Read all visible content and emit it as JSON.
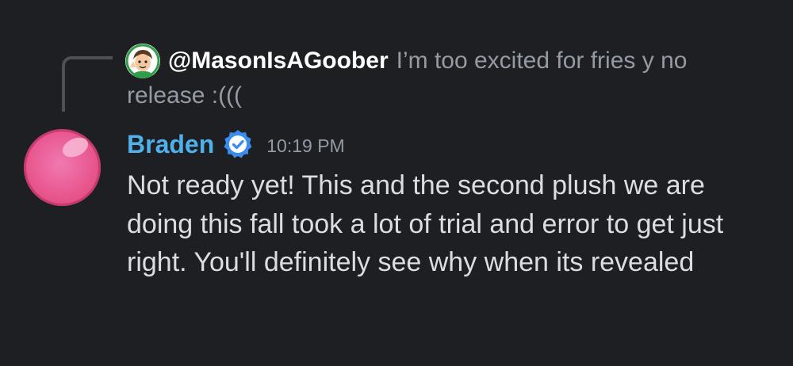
{
  "reply": {
    "author": "@MasonIsAGoober",
    "text": "I’m too excited for fries y no release :((("
  },
  "message": {
    "author": "Braden",
    "timestamp": "10:19 PM",
    "text": "Not ready yet! This and the second plush we are doing this fall took a lot of trial and error to get just right. You'll definitely see why when its revealed"
  },
  "colors": {
    "background": "#1e1f22",
    "author_name": "#4fb0eb",
    "verified_badge": "#3b8ded",
    "muted_text": "#949ba4",
    "body_text": "#dbdee1",
    "avatar_pink": "#e9578f"
  },
  "icons": {
    "verified": "verified-check-badge-icon"
  }
}
